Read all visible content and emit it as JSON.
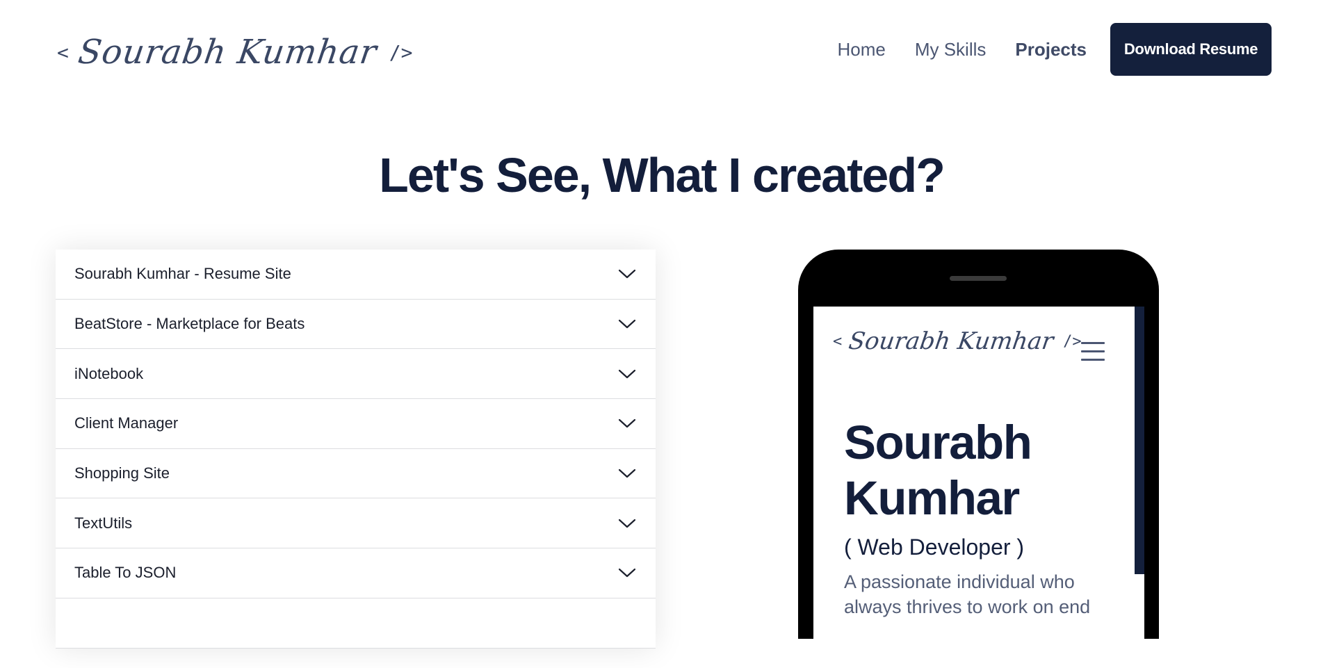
{
  "header": {
    "logo": {
      "open": "<",
      "name": "Sourabh Kumhar",
      "close": "/>"
    },
    "nav": [
      {
        "label": "Home",
        "active": false
      },
      {
        "label": "My Skills",
        "active": false
      },
      {
        "label": "Projects",
        "active": true
      }
    ],
    "download_label": "Download Resume"
  },
  "section": {
    "title": "Let's See, What I created?"
  },
  "projects": [
    {
      "label": "Sourabh Kumhar - Resume Site"
    },
    {
      "label": "BeatStore - Marketplace for Beats"
    },
    {
      "label": "iNotebook"
    },
    {
      "label": "Client Manager"
    },
    {
      "label": "Shopping Site"
    },
    {
      "label": "TextUtils"
    },
    {
      "label": "Table To JSON"
    },
    {
      "label": ""
    }
  ],
  "preview": {
    "logo": {
      "open": "<",
      "name": "Sourabh Kumhar",
      "close": "/>"
    },
    "name": "Sourabh Kumhar",
    "role": "( Web Developer )",
    "description": "A passionate individual who always thrives to work on end"
  },
  "colors": {
    "primary": "#14203c",
    "text": "#131e3b",
    "muted": "#545e77"
  },
  "icons": {
    "chevron": "chevron-down-icon",
    "menu": "hamburger-menu-icon"
  }
}
